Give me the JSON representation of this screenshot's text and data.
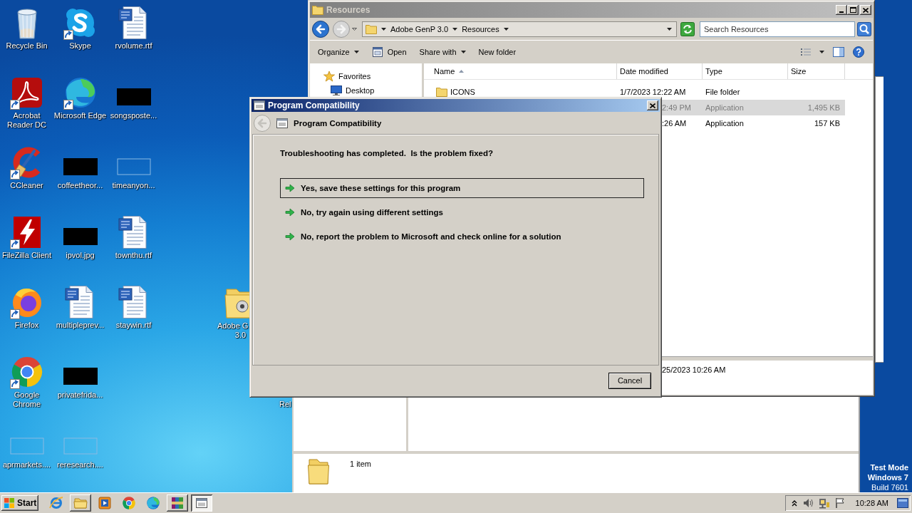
{
  "desktop": {
    "icons": [
      {
        "label": "Recycle Bin",
        "kind": "recyclebin",
        "shortcut": false
      },
      {
        "label": "Acrobat Reader DC",
        "kind": "acrobat",
        "shortcut": true
      },
      {
        "label": "CCleaner",
        "kind": "ccleaner",
        "shortcut": true
      },
      {
        "label": "FileZilla Client",
        "kind": "filezilla",
        "shortcut": true
      },
      {
        "label": "Firefox",
        "kind": "firefox",
        "shortcut": true
      },
      {
        "label": "Google Chrome",
        "kind": "chrome",
        "shortcut": true
      },
      {
        "label": "aprmarkets....",
        "kind": "blank",
        "shortcut": false
      },
      {
        "label": "Skype",
        "kind": "skype",
        "shortcut": true
      },
      {
        "label": "Microsoft Edge",
        "kind": "edge",
        "shortcut": true
      },
      {
        "label": "coffeetheor...",
        "kind": "thumbnail",
        "shortcut": false
      },
      {
        "label": "ipvol.jpg",
        "kind": "thumbnail",
        "shortcut": false
      },
      {
        "label": "multipleprev...",
        "kind": "document",
        "shortcut": false
      },
      {
        "label": "privatefrida...",
        "kind": "thumbnail",
        "shortcut": false
      },
      {
        "label": "reresearch....",
        "kind": "blank",
        "shortcut": false
      },
      {
        "label": "rvolume.rtf",
        "kind": "document",
        "shortcut": false
      },
      {
        "label": "songsposte...",
        "kind": "thumbnail",
        "shortcut": false
      },
      {
        "label": "timeanyon...",
        "kind": "blank",
        "shortcut": false
      },
      {
        "label": "townthu.rtf",
        "kind": "document",
        "shortcut": false
      },
      {
        "label": "staywin.rtf",
        "kind": "document",
        "shortcut": false
      }
    ],
    "partial_icons": [
      {
        "kind": "folder",
        "lines": [
          "Adobe G",
          "3.0"
        ]
      },
      {
        "kind": "hidden",
        "lines": [
          "Rel"
        ]
      }
    ],
    "system_text": [
      "Test Mode",
      "Windows 7",
      "Build 7601"
    ]
  },
  "explorer": {
    "title": "Resources",
    "breadcrumb": [
      "Adobe GenP 3.0",
      "Resources"
    ],
    "search": {
      "placeholder": "Search Resources"
    },
    "toolbar": [
      {
        "label": "Organize",
        "kind": "menu"
      },
      {
        "label": "Open",
        "kind": "open"
      },
      {
        "label": "Share with",
        "kind": "menu"
      },
      {
        "label": "New folder",
        "kind": "plain"
      }
    ],
    "nav": [
      {
        "label": "Favorites",
        "kind": "favorites",
        "children": [
          {
            "label": "Desktop",
            "kind": "desktop"
          }
        ]
      }
    ],
    "columns": [
      {
        "label": "Name",
        "sorted": true
      },
      {
        "label": "Date modified",
        "sorted": false
      },
      {
        "label": "Type",
        "sorted": false
      },
      {
        "label": "Size",
        "sorted": false
      }
    ],
    "rows": [
      {
        "name": "ICONS",
        "date": "1/7/2023 12:22 AM",
        "type": "File folder",
        "selected": false
      },
      {
        "date": "2:49 PM",
        "type": "Application",
        "size": "1,495 KB",
        "selected": true
      },
      {
        "date": ":26 AM",
        "type": "Application",
        "size": "157 KB",
        "selected": false
      }
    ],
    "details": "25/2023 10:26 AM"
  },
  "background_explorer": {
    "status": "1 item"
  },
  "dialog": {
    "title": "Program Compatibility",
    "heading": "Program Compatibility",
    "question": "Troubleshooting has completed.  Is the problem fixed?",
    "options": [
      {
        "label": "Yes, save these settings for this program",
        "selected": true
      },
      {
        "label": "No, try again using different settings",
        "selected": false
      },
      {
        "label": "No, report the problem to Microsoft and check online for a solution",
        "selected": false
      }
    ],
    "cancel": "Cancel"
  },
  "taskbar": {
    "start": "Start",
    "items": [
      {
        "kind": "ie",
        "running": false,
        "selected": false
      },
      {
        "kind": "explorer",
        "running": true,
        "selected": false
      },
      {
        "kind": "media",
        "running": false,
        "selected": false
      },
      {
        "kind": "chrome",
        "running": false,
        "selected": false
      },
      {
        "kind": "edge",
        "running": false,
        "selected": false
      },
      {
        "kind": "archive",
        "running": true,
        "selected": false
      },
      {
        "kind": "compat",
        "running": true,
        "selected": true
      }
    ],
    "clock": "10:28 AM"
  }
}
